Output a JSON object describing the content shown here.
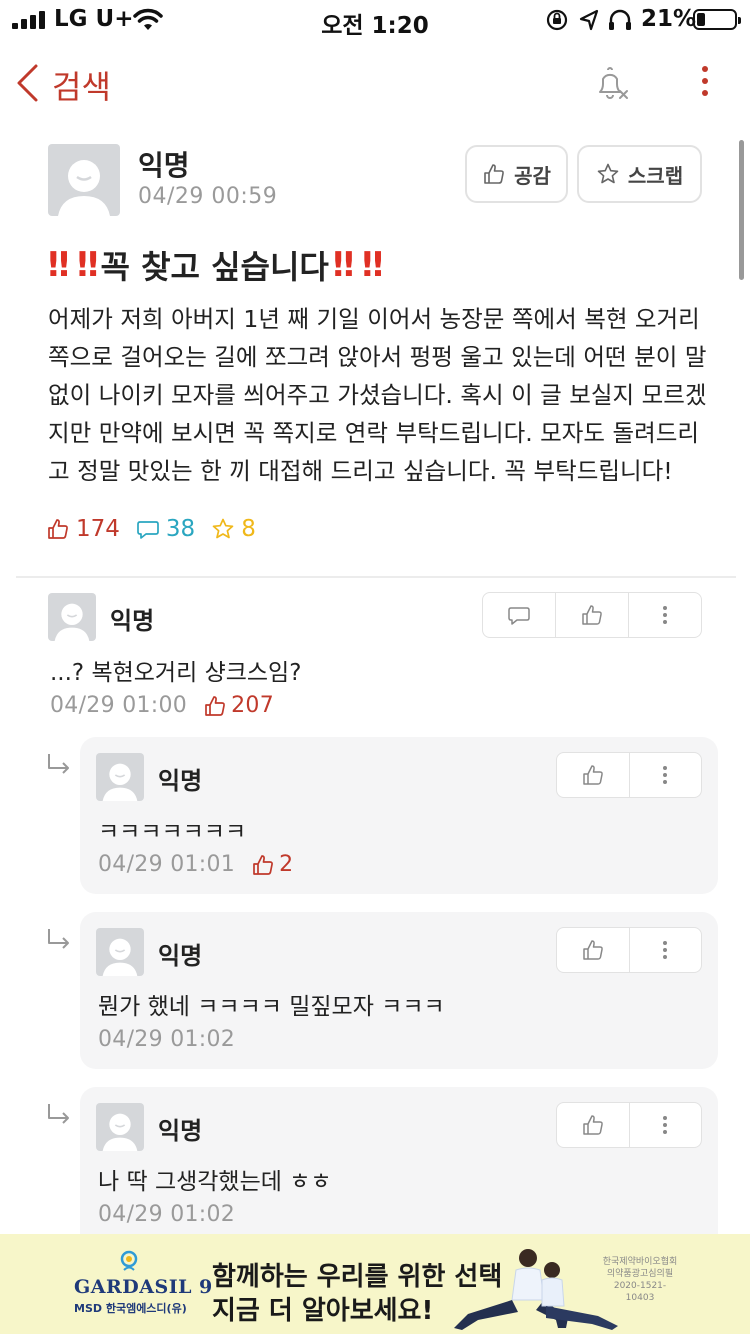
{
  "status_bar": {
    "carrier": "LG U+",
    "time": "오전 1:20",
    "battery": "21%",
    "battery_level": 0.21
  },
  "nav": {
    "back_label": "검색"
  },
  "post": {
    "author": "익명",
    "date": "04/29 00:59",
    "like_button": "공감",
    "scrap_button": "스크랩",
    "title_marks_left": "‼ ‼",
    "title": "꼭 찾고 싶습니다",
    "title_marks_right": "‼ ‼",
    "body": "어제가 저희 아버지 1년 째 기일 이어서 농장문 쪽에서 복현 오거리 쪽으로 걸어오는 길에 쪼그려 앉아서 펑펑 울고 있는데 어떤 분이 말 없이 나이키 모자를 씌어주고 가셨습니다. 혹시 이 글 보실지 모르겠지만 만약에 보시면 꼭 쪽지로 연락 부탁드립니다. 모자도 돌려드리고 정말 맛있는 한 끼 대접해 드리고 싶습니다. 꼭 부탁드립니다!",
    "likes": "174",
    "comments": "38",
    "scraps": "8"
  },
  "comments": [
    {
      "author": "익명",
      "text": "...? 복현오거리 샹크스임?",
      "date": "04/29 01:00",
      "likes": "207",
      "replies": [
        {
          "author": "익명",
          "text": "ㅋㅋㅋㅋㅋㅋㅋ",
          "date": "04/29 01:01",
          "likes": "2"
        },
        {
          "author": "익명",
          "text": "뭔가 했네 ㅋㅋㅋㅋ 밀짚모자 ㅋㅋㅋ",
          "date": "04/29 01:02",
          "likes": ""
        },
        {
          "author": "익명",
          "text": "나 딱 그생각했는데 ㅎㅎ",
          "date": "04/29 01:02",
          "likes": ""
        }
      ]
    }
  ],
  "ad": {
    "brand": "GARDASIL 9",
    "sponsor": "MSD 한국엠에스디(유)",
    "headline_1": "함께하는 우리를 위한 선택",
    "headline_2": "지금 더 알아보세요!",
    "fine_print": "한국제약바이오협회 의약품광고심의필 2020-1521-10403"
  },
  "colors": {
    "accent": "#c0392b",
    "comment_count": "#2aa6c0",
    "scrap_count": "#f0b81a",
    "ad_background": "#f7f6c9"
  }
}
